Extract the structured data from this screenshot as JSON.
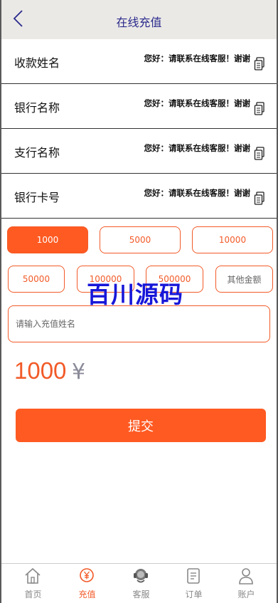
{
  "header": {
    "title": "在线充值"
  },
  "bank_info": [
    {
      "label": "收款姓名",
      "value": "您好：请联系在线客服！谢谢"
    },
    {
      "label": "银行名称",
      "value": "您好：请联系在线客服！谢谢"
    },
    {
      "label": "支行名称",
      "value": "您好：请联系在线客服！谢谢"
    },
    {
      "label": "银行卡号",
      "value": "您好：请联系在线客服！谢谢"
    }
  ],
  "amounts": [
    "1000",
    "5000",
    "10000",
    "50000",
    "100000",
    "500000",
    "其他金额"
  ],
  "selected_amount_index": 0,
  "name_input": {
    "placeholder": "请输入充值姓名",
    "value": ""
  },
  "watermark": "百川源码",
  "amount_display": {
    "value": "1000",
    "currency": "¥"
  },
  "submit_label": "提交",
  "tabs": [
    {
      "label": "首页",
      "icon": "home-icon"
    },
    {
      "label": "充值",
      "icon": "recharge-icon"
    },
    {
      "label": "客服",
      "icon": "customer-service-icon"
    },
    {
      "label": "订单",
      "icon": "orders-icon"
    },
    {
      "label": "账户",
      "icon": "account-icon"
    }
  ],
  "active_tab_index": 1,
  "colors": {
    "accent": "#ff5a22",
    "header_bg": "#ebe9e6",
    "title": "#2a2a8c",
    "watermark": "#1717d9"
  }
}
